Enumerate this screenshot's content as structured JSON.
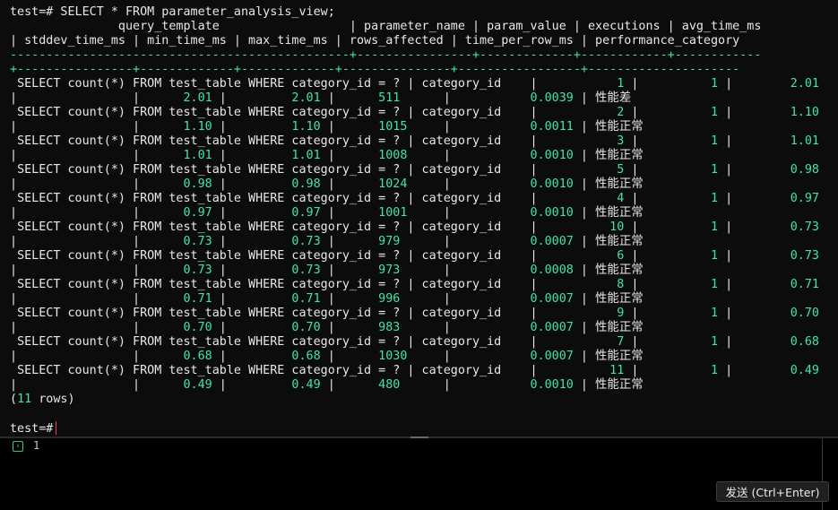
{
  "terminal": {
    "command_line": "test=# SELECT * FROM parameter_analysis_view;",
    "header_1": "               query_template                  | parameter_name | param_value | executions | avg_time_ms",
    "header_2": "| stddev_time_ms | min_time_ms | max_time_ms | rows_affected | time_per_row_ms | performance_category",
    "divider_1": "-----------------------------------------------+----------------+-------------+------------+------------",
    "divider_2": "+----------------+-------------+-------------+---------------+-----------------+---------------------",
    "rows": [
      {
        "query_template": "SELECT count(*) FROM test_table WHERE category_id = ?",
        "parameter_name": "category_id",
        "param_value": "1",
        "executions": "1",
        "avg_time_ms": "2.01",
        "stddev_time_ms": "",
        "min_time_ms": "2.01",
        "max_time_ms": "2.01",
        "rows_affected": "511",
        "time_per_row_ms": "0.0039",
        "performance_category": "性能差"
      },
      {
        "query_template": "SELECT count(*) FROM test_table WHERE category_id = ?",
        "parameter_name": "category_id",
        "param_value": "2",
        "executions": "1",
        "avg_time_ms": "1.10",
        "stddev_time_ms": "",
        "min_time_ms": "1.10",
        "max_time_ms": "1.10",
        "rows_affected": "1015",
        "time_per_row_ms": "0.0011",
        "performance_category": "性能正常"
      },
      {
        "query_template": "SELECT count(*) FROM test_table WHERE category_id = ?",
        "parameter_name": "category_id",
        "param_value": "3",
        "executions": "1",
        "avg_time_ms": "1.01",
        "stddev_time_ms": "",
        "min_time_ms": "1.01",
        "max_time_ms": "1.01",
        "rows_affected": "1008",
        "time_per_row_ms": "0.0010",
        "performance_category": "性能正常"
      },
      {
        "query_template": "SELECT count(*) FROM test_table WHERE category_id = ?",
        "parameter_name": "category_id",
        "param_value": "5",
        "executions": "1",
        "avg_time_ms": "0.98",
        "stddev_time_ms": "",
        "min_time_ms": "0.98",
        "max_time_ms": "0.98",
        "rows_affected": "1024",
        "time_per_row_ms": "0.0010",
        "performance_category": "性能正常"
      },
      {
        "query_template": "SELECT count(*) FROM test_table WHERE category_id = ?",
        "parameter_name": "category_id",
        "param_value": "4",
        "executions": "1",
        "avg_time_ms": "0.97",
        "stddev_time_ms": "",
        "min_time_ms": "0.97",
        "max_time_ms": "0.97",
        "rows_affected": "1001",
        "time_per_row_ms": "0.0010",
        "performance_category": "性能正常"
      },
      {
        "query_template": "SELECT count(*) FROM test_table WHERE category_id = ?",
        "parameter_name": "category_id",
        "param_value": "10",
        "executions": "1",
        "avg_time_ms": "0.73",
        "stddev_time_ms": "",
        "min_time_ms": "0.73",
        "max_time_ms": "0.73",
        "rows_affected": "979",
        "time_per_row_ms": "0.0007",
        "performance_category": "性能正常"
      },
      {
        "query_template": "SELECT count(*) FROM test_table WHERE category_id = ?",
        "parameter_name": "category_id",
        "param_value": "6",
        "executions": "1",
        "avg_time_ms": "0.73",
        "stddev_time_ms": "",
        "min_time_ms": "0.73",
        "max_time_ms": "0.73",
        "rows_affected": "973",
        "time_per_row_ms": "0.0008",
        "performance_category": "性能正常"
      },
      {
        "query_template": "SELECT count(*) FROM test_table WHERE category_id = ?",
        "parameter_name": "category_id",
        "param_value": "8",
        "executions": "1",
        "avg_time_ms": "0.71",
        "stddev_time_ms": "",
        "min_time_ms": "0.71",
        "max_time_ms": "0.71",
        "rows_affected": "996",
        "time_per_row_ms": "0.0007",
        "performance_category": "性能正常"
      },
      {
        "query_template": "SELECT count(*) FROM test_table WHERE category_id = ?",
        "parameter_name": "category_id",
        "param_value": "9",
        "executions": "1",
        "avg_time_ms": "0.70",
        "stddev_time_ms": "",
        "min_time_ms": "0.70",
        "max_time_ms": "0.70",
        "rows_affected": "983",
        "time_per_row_ms": "0.0007",
        "performance_category": "性能正常"
      },
      {
        "query_template": "SELECT count(*) FROM test_table WHERE category_id = ?",
        "parameter_name": "category_id",
        "param_value": "7",
        "executions": "1",
        "avg_time_ms": "0.68",
        "stddev_time_ms": "",
        "min_time_ms": "0.68",
        "max_time_ms": "0.68",
        "rows_affected": "1030",
        "time_per_row_ms": "0.0007",
        "performance_category": "性能正常"
      },
      {
        "query_template": "SELECT count(*) FROM test_table WHERE category_id = ?",
        "parameter_name": "category_id",
        "param_value": "11",
        "executions": "1",
        "avg_time_ms": "0.49",
        "stddev_time_ms": "",
        "min_time_ms": "0.49",
        "max_time_ms": "0.49",
        "rows_affected": "480",
        "time_per_row_ms": "0.0010",
        "performance_category": "性能正常"
      }
    ],
    "row_count_open": "(",
    "row_count_number": "11",
    "row_count_close": " rows)",
    "prompt": "test=#"
  },
  "editor": {
    "prompt_icon": "chevron-right-icon",
    "line_number": "1",
    "send_button_label": "发送 (Ctrl+Enter)"
  },
  "colors": {
    "background": "#0c0c0c",
    "text": "#e8e8e8",
    "numeric": "#3fe6a6",
    "cursor": "#e8434c"
  }
}
